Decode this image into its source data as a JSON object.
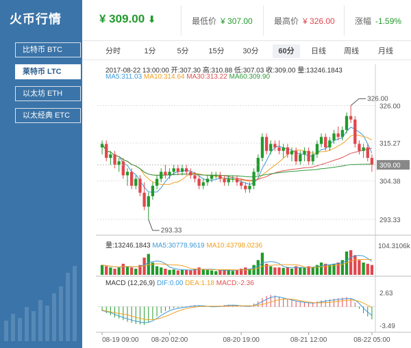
{
  "sidebar": {
    "brand": "火币行情",
    "coins": [
      {
        "label": "比特币 BTC",
        "active": false
      },
      {
        "label": "莱特币 LTC",
        "active": true
      },
      {
        "label": "以太坊 ETH",
        "active": false
      },
      {
        "label": "以太经典 ETC",
        "active": false
      }
    ]
  },
  "header": {
    "price": "¥ 309.00",
    "trend_icon": "arrow-down-icon",
    "low_label": "最低价",
    "low_value": "¥ 307.00",
    "high_label": "最高价",
    "high_value": "¥ 326.00",
    "change_label": "涨幅",
    "change_value": "-1.59%"
  },
  "tabs": [
    "分时",
    "1分",
    "5分",
    "15分",
    "30分",
    "60分",
    "日线",
    "周线",
    "月线"
  ],
  "active_tab": "60分",
  "candle_info": {
    "line": "2017-08-22 13:00:00  开:307.30 高:310.88 低:307.03 收:309.00 量:13246.1843",
    "ma5": "MA5:311.03",
    "ma10": "MA10:314.64",
    "ma30": "MA30:313.22",
    "ma60": "MA60:309.90"
  },
  "volume_info": {
    "vol": "量:13246.1843",
    "ma5": "MA5:30778.9619",
    "ma10": "MA10:43798.0236"
  },
  "macd_info": {
    "label": "MACD (12,26,9)",
    "dif": "DIF:0.00",
    "dea": "DEA:1.18",
    "macd": "MACD:-2.36"
  },
  "colors": {
    "up": "#229a2c",
    "down": "#e0474c",
    "ma5": "#3b9ad9",
    "ma10": "#f0a020",
    "ma30": "#e05050",
    "ma60": "#2e9a3a",
    "sidebar": "#3b74a8"
  },
  "chart_data": {
    "type": "candlestick",
    "price_axis": [
      "326.00",
      "315.27",
      "304.38",
      "293.33"
    ],
    "current_price_tag": "309.00",
    "high_marker": "326.00",
    "low_marker": "293.33",
    "volume_axis": [
      "104.3106k"
    ],
    "macd_axis": [
      "2.63",
      "-3.49"
    ],
    "x_ticks": [
      "08-19 09:00",
      "08-20 02:00",
      "08-20 19:00",
      "08-21 12:00",
      "08-22 05:00"
    ],
    "candles": [
      [
        314,
        316,
        312,
        315
      ],
      [
        315,
        316,
        310,
        311
      ],
      [
        311,
        313,
        309,
        312
      ],
      [
        312,
        313,
        308,
        309
      ],
      [
        309,
        311,
        307,
        310
      ],
      [
        310,
        311,
        305,
        306
      ],
      [
        306,
        308,
        303,
        307
      ],
      [
        307,
        308,
        302,
        303
      ],
      [
        303,
        306,
        302,
        305
      ],
      [
        305,
        306,
        300,
        301
      ],
      [
        301,
        304,
        296,
        297
      ],
      [
        297,
        301,
        293.33,
        300
      ],
      [
        300,
        304,
        299,
        303
      ],
      [
        303,
        306,
        302,
        305
      ],
      [
        305,
        308,
        304,
        307
      ],
      [
        307,
        309,
        305,
        306
      ],
      [
        306,
        308,
        305,
        307
      ],
      [
        307,
        309,
        306,
        308
      ],
      [
        308,
        309,
        306,
        307
      ],
      [
        307,
        309,
        306,
        308
      ],
      [
        308,
        309,
        306,
        307
      ],
      [
        307,
        308,
        305,
        306
      ],
      [
        306,
        307,
        304,
        305
      ],
      [
        305,
        306,
        302,
        303
      ],
      [
        303,
        305,
        302,
        304
      ],
      [
        304,
        306,
        303,
        305
      ],
      [
        305,
        307,
        304,
        306
      ],
      [
        306,
        307,
        305,
        306
      ],
      [
        306,
        307,
        304,
        305
      ],
      [
        305,
        306,
        303,
        304
      ],
      [
        304,
        306,
        303,
        305
      ],
      [
        305,
        306,
        304,
        305
      ],
      [
        305,
        306,
        303,
        304
      ],
      [
        304,
        305,
        302,
        303
      ],
      [
        303,
        304,
        301,
        302
      ],
      [
        302,
        304,
        301,
        303
      ],
      [
        303,
        308,
        302,
        307
      ],
      [
        307,
        312,
        306,
        311
      ],
      [
        311,
        318,
        310,
        317
      ],
      [
        317,
        318,
        312,
        313
      ],
      [
        313,
        316,
        312,
        315
      ],
      [
        315,
        316,
        313,
        314
      ],
      [
        314,
        316,
        312,
        313
      ],
      [
        313,
        315,
        311,
        314
      ],
      [
        314,
        315,
        311,
        312
      ],
      [
        312,
        314,
        310,
        313
      ],
      [
        313,
        314,
        309,
        310
      ],
      [
        310,
        313,
        309,
        312
      ],
      [
        312,
        314,
        310,
        313
      ],
      [
        313,
        314,
        309,
        310
      ],
      [
        310,
        313,
        309,
        312
      ],
      [
        312,
        316,
        311,
        315
      ],
      [
        315,
        318,
        314,
        317
      ],
      [
        317,
        318,
        313,
        314
      ],
      [
        314,
        317,
        313,
        316
      ],
      [
        316,
        319,
        315,
        318
      ],
      [
        318,
        320,
        316,
        317
      ],
      [
        317,
        320,
        316,
        319
      ],
      [
        319,
        324,
        318,
        323
      ],
      [
        323,
        326,
        321,
        322
      ],
      [
        322,
        323,
        314,
        315
      ],
      [
        315,
        316,
        312,
        313
      ],
      [
        313,
        315,
        311,
        314
      ],
      [
        314,
        315,
        310,
        311
      ],
      [
        311,
        312,
        307,
        309
      ]
    ],
    "volumes": [
      40,
      35,
      30,
      25,
      30,
      45,
      35,
      30,
      25,
      40,
      70,
      85,
      50,
      35,
      30,
      25,
      20,
      22,
      18,
      20,
      20,
      18,
      25,
      30,
      22,
      20,
      18,
      15,
      20,
      22,
      18,
      16,
      20,
      25,
      30,
      25,
      40,
      60,
      90,
      45,
      35,
      30,
      30,
      28,
      30,
      25,
      35,
      30,
      28,
      35,
      30,
      40,
      50,
      45,
      40,
      45,
      50,
      60,
      95,
      100,
      80,
      60,
      50,
      45,
      40
    ],
    "macd": [
      -0.8,
      -1.2,
      -1.6,
      -2.0,
      -2.2,
      -2.5,
      -2.8,
      -3.0,
      -3.2,
      -3.3,
      -3.4,
      -3.0,
      -2.4,
      -1.8,
      -1.2,
      -0.8,
      -0.5,
      -0.3,
      -0.2,
      -0.1,
      0.1,
      0.2,
      0.3,
      0.2,
      0.1,
      0.0,
      -0.1,
      0.1,
      0.2,
      0.3,
      0.4,
      0.3,
      0.2,
      0.1,
      0.0,
      0.2,
      0.6,
      1.0,
      1.6,
      2.0,
      2.2,
      2.1,
      1.8,
      1.6,
      1.4,
      1.2,
      1.0,
      0.9,
      0.8,
      0.7,
      0.8,
      1.0,
      1.2,
      1.3,
      1.4,
      1.5,
      1.6,
      1.7,
      1.8,
      1.6,
      0.8,
      -0.4,
      -1.2,
      -1.8,
      -2.36
    ]
  }
}
